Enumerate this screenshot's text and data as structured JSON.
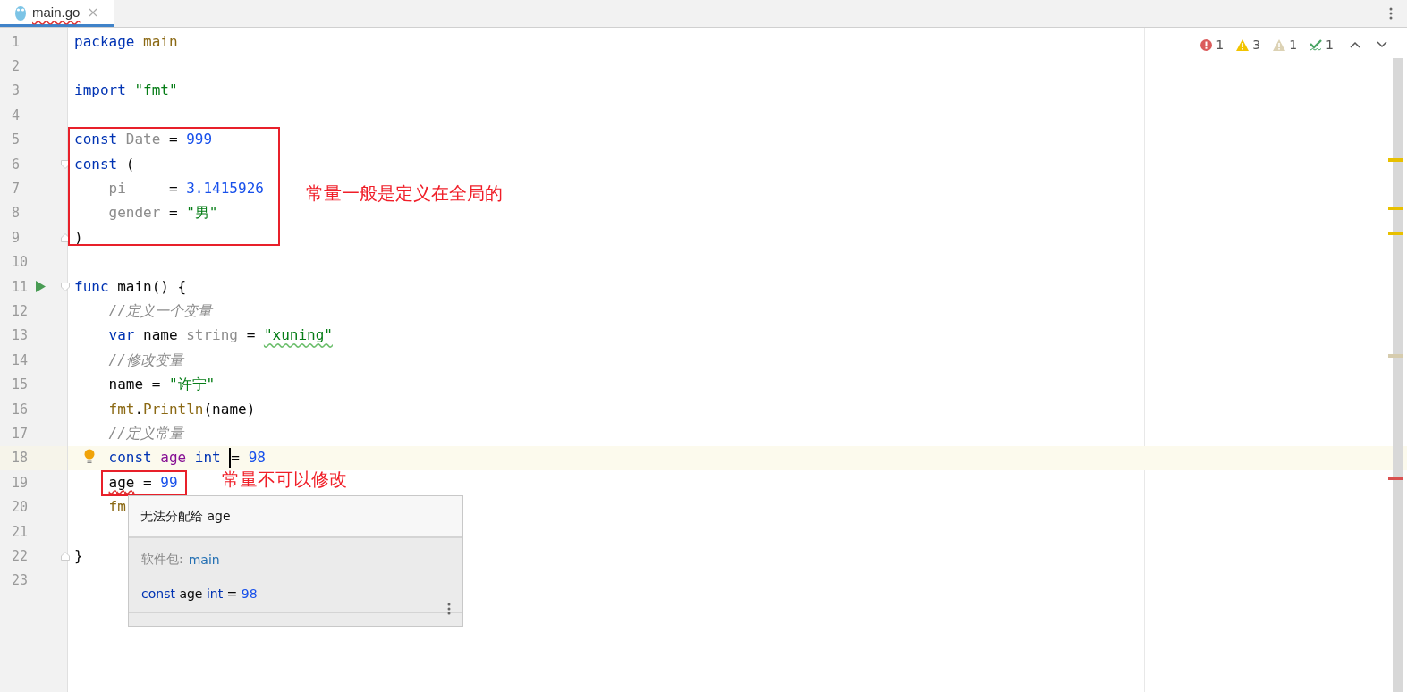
{
  "tab": {
    "label": "main.go",
    "selected": true,
    "has_error": true
  },
  "inspections": [
    {
      "kind": "error",
      "count": "1"
    },
    {
      "kind": "warning",
      "count": "3"
    },
    {
      "kind": "weak",
      "count": "1"
    },
    {
      "kind": "typo",
      "count": "1"
    }
  ],
  "lines": [
    {
      "number": "1",
      "tokens": [
        {
          "text": "package ",
          "kind": "keyword"
        },
        {
          "text": "main",
          "kind": "package"
        }
      ]
    },
    {
      "number": "2"
    },
    {
      "number": "3",
      "tokens": [
        {
          "text": "import ",
          "kind": "keyword"
        },
        {
          "text": "\"fmt\"",
          "kind": "string"
        }
      ]
    },
    {
      "number": "4"
    },
    {
      "number": "5",
      "stripe": {
        "color": "#e8c000"
      },
      "tokens": [
        {
          "text": "const ",
          "kind": "keyword"
        },
        {
          "text": "Date",
          "kind": "unused"
        },
        {
          "text": " = ",
          "kind": "plain"
        },
        {
          "text": "999",
          "kind": "number"
        }
      ]
    },
    {
      "number": "6",
      "fold_start": true,
      "tokens": [
        {
          "text": "const ",
          "kind": "keyword"
        },
        {
          "text": "(",
          "kind": "plain"
        }
      ]
    },
    {
      "number": "7",
      "indented": true,
      "stripe": {
        "color": "#e8c000"
      },
      "tokens": [
        {
          "text": "pi     ",
          "kind": "unused"
        },
        {
          "text": "= ",
          "kind": "plain"
        },
        {
          "text": "3.1415926",
          "kind": "number"
        }
      ]
    },
    {
      "number": "8",
      "indented": true,
      "stripe": {
        "color": "#e8c000"
      },
      "tokens": [
        {
          "text": "gender ",
          "kind": "unused"
        },
        {
          "text": "= ",
          "kind": "plain"
        },
        {
          "text": "\"男\"",
          "kind": "string"
        }
      ]
    },
    {
      "number": "9",
      "fold_end": true,
      "tokens": [
        {
          "text": ")",
          "kind": "plain"
        }
      ]
    },
    {
      "number": "10"
    },
    {
      "number": "11",
      "run": true,
      "fold_start": true,
      "tokens": [
        {
          "text": "func ",
          "kind": "keyword"
        },
        {
          "text": "main",
          "kind": "plain"
        },
        {
          "text": "() {",
          "kind": "plain"
        }
      ]
    },
    {
      "number": "12",
      "indented": true,
      "tokens": [
        {
          "text": "//定义一个变量",
          "kind": "comment"
        }
      ]
    },
    {
      "number": "13",
      "indented": true,
      "stripe": {
        "color": "#d6ccae"
      },
      "tokens": [
        {
          "text": "var ",
          "kind": "keyword"
        },
        {
          "text": "name ",
          "kind": "plain"
        },
        {
          "text": "string",
          "kind": "unused"
        },
        {
          "text": " = ",
          "kind": "plain"
        },
        {
          "text": "\"xuning\"",
          "kind": "string",
          "misspelled": true
        }
      ]
    },
    {
      "number": "14",
      "indented": true,
      "tokens": [
        {
          "text": "//修改变量",
          "kind": "comment"
        }
      ]
    },
    {
      "number": "15",
      "indented": true,
      "tokens": [
        {
          "text": "name = ",
          "kind": "plain"
        },
        {
          "text": "\"许宁\"",
          "kind": "string"
        }
      ]
    },
    {
      "number": "16",
      "indented": true,
      "tokens": [
        {
          "text": "fmt",
          "kind": "package"
        },
        {
          "text": ".",
          "kind": "plain"
        },
        {
          "text": "Println",
          "kind": "package"
        },
        {
          "text": "(name)",
          "kind": "plain"
        }
      ]
    },
    {
      "number": "17",
      "indented": true,
      "tokens": [
        {
          "text": "//定义常量",
          "kind": "comment"
        }
      ]
    },
    {
      "number": "18",
      "indented": true,
      "current": true,
      "bulb": true,
      "stripe": {
        "color": "#d95050"
      },
      "tokens": [
        {
          "text": "const ",
          "kind": "keyword"
        },
        {
          "text": "age ",
          "kind": "constant"
        },
        {
          "text": "int ",
          "kind": "keyword"
        },
        {
          "text": "= ",
          "kind": "plain",
          "caret": true
        },
        {
          "text": "98",
          "kind": "number"
        }
      ]
    },
    {
      "number": "19",
      "indented": true,
      "tokens": [
        {
          "text": "age",
          "kind": "plain",
          "error": true
        },
        {
          "text": " = ",
          "kind": "plain"
        },
        {
          "text": "99",
          "kind": "number"
        }
      ]
    },
    {
      "number": "20",
      "indented": true,
      "tokens": [
        {
          "text": "fm",
          "kind": "package"
        }
      ]
    },
    {
      "number": "21"
    },
    {
      "number": "22",
      "fold_end": true,
      "tokens": [
        {
          "text": "}",
          "kind": "plain"
        }
      ]
    },
    {
      "number": "23"
    }
  ],
  "annotations": [
    "常量一般是定义在全局的",
    "常量不可以修改"
  ],
  "tooltip": {
    "title": "无法分配给 age",
    "package_label": "软件包:",
    "package": "main",
    "tokens": [
      {
        "text": "const ",
        "kind": "keyword"
      },
      {
        "text": "age ",
        "kind": "plain"
      },
      {
        "text": "int",
        "kind": "keyword"
      },
      {
        "text": " = ",
        "kind": "plain"
      },
      {
        "text": "98",
        "kind": "number"
      }
    ]
  }
}
